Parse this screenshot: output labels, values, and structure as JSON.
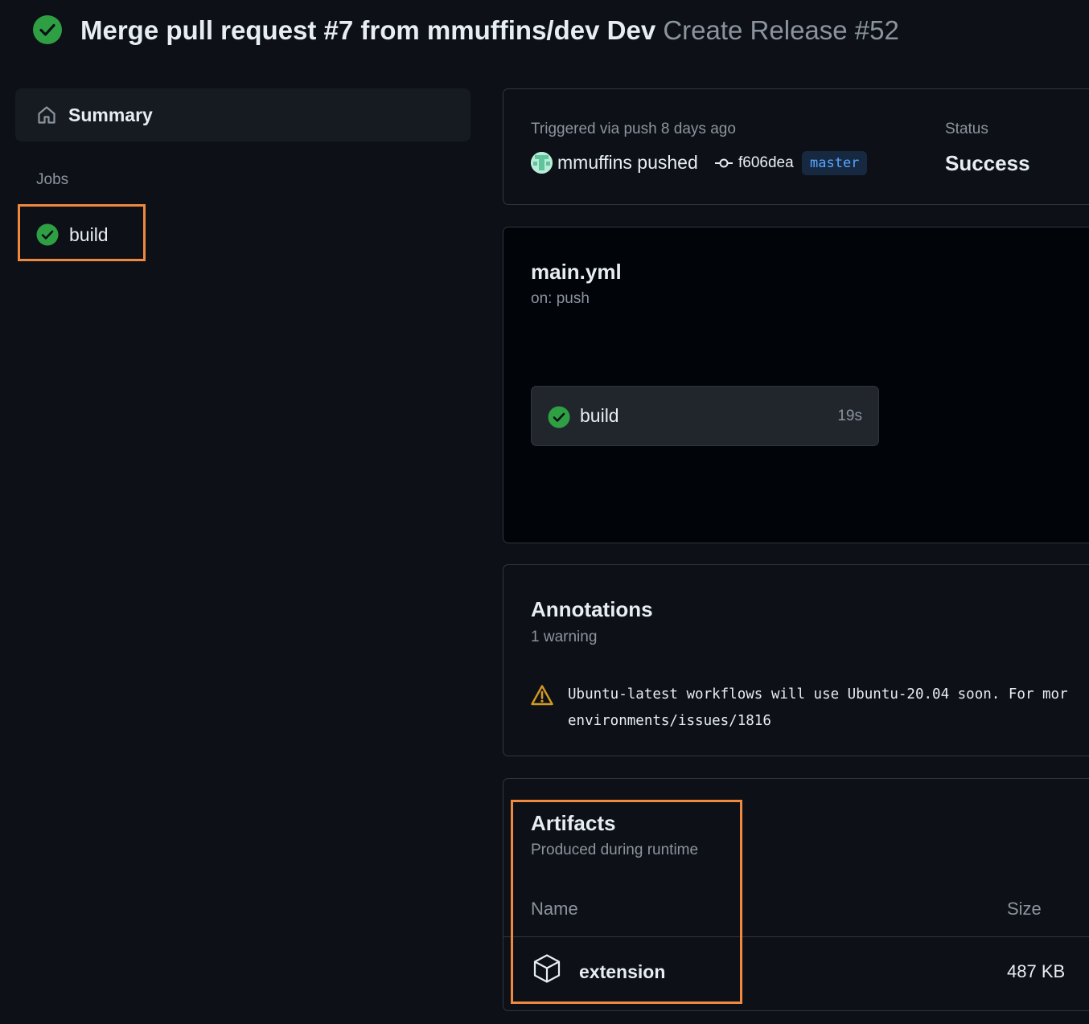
{
  "header": {
    "title": "Merge pull request #7 from mmuffins/dev Dev",
    "workflow_run": "Create Release #52",
    "status_icon": "check-circle-fill-icon"
  },
  "sidebar": {
    "summary_label": "Summary",
    "summary_icon": "home-icon",
    "jobs_heading": "Jobs",
    "jobs": [
      {
        "label": "build",
        "status": "success"
      }
    ]
  },
  "trigger": {
    "text": "Triggered via push 8 days ago",
    "actor": "mmuffins",
    "action": "pushed",
    "commit_sha": "f606dea",
    "branch": "master",
    "status_label": "Status",
    "status_value": "Success"
  },
  "workflow": {
    "file": "main.yml",
    "trigger": "on: push",
    "job": {
      "label": "build",
      "duration": "19s"
    }
  },
  "annotations": {
    "title": "Annotations",
    "count": "1 warning",
    "warning_line1": "Ubuntu-latest workflows will use Ubuntu-20.04 soon. For mor",
    "warning_line2": "environments/issues/1816"
  },
  "artifacts": {
    "title": "Artifacts",
    "subtitle": "Produced during runtime",
    "col_name": "Name",
    "col_size": "Size",
    "items": [
      {
        "name": "extension",
        "size": "487 KB"
      }
    ]
  },
  "colors": {
    "background": "#0d1117",
    "success": "#2ea043",
    "highlight": "#f0883e",
    "link": "#58a6ff",
    "warning": "#d29922"
  }
}
